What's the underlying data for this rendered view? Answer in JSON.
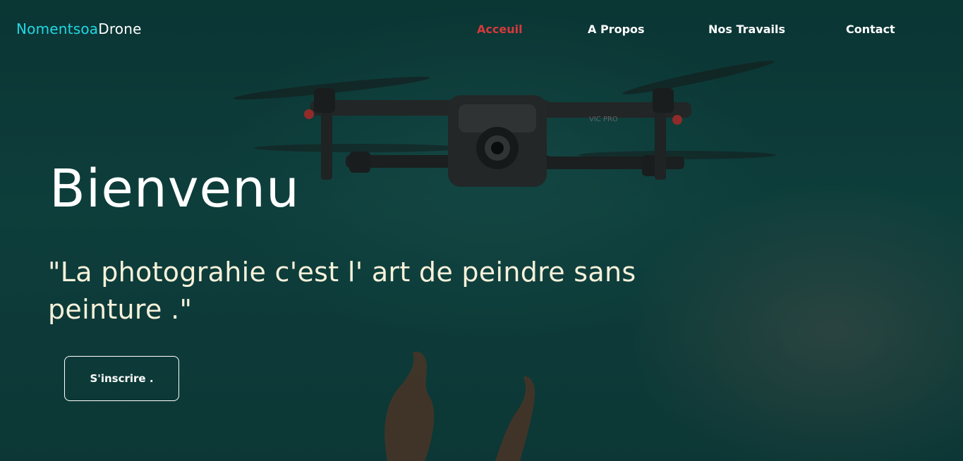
{
  "brand": {
    "part1": "Nomentsoa",
    "part2": "Drone",
    "accent_color": "#22d7e3"
  },
  "nav": {
    "items": [
      {
        "label": "Acceuil",
        "active": true
      },
      {
        "label": "A Propos",
        "active": false
      },
      {
        "label": "Nos Travails",
        "active": false
      },
      {
        "label": "Contact",
        "active": false
      }
    ],
    "active_color": "#d6393d"
  },
  "hero": {
    "title": "Bienvenu",
    "quote": "\"La photograhie c'est l' art de peindre sans peinture .\"",
    "cta_label": "S'inscrire .",
    "drone_text": "VIC PRO"
  },
  "colors": {
    "background": "#114744",
    "text": "#ffffff",
    "quote_text": "#f7f1da"
  }
}
